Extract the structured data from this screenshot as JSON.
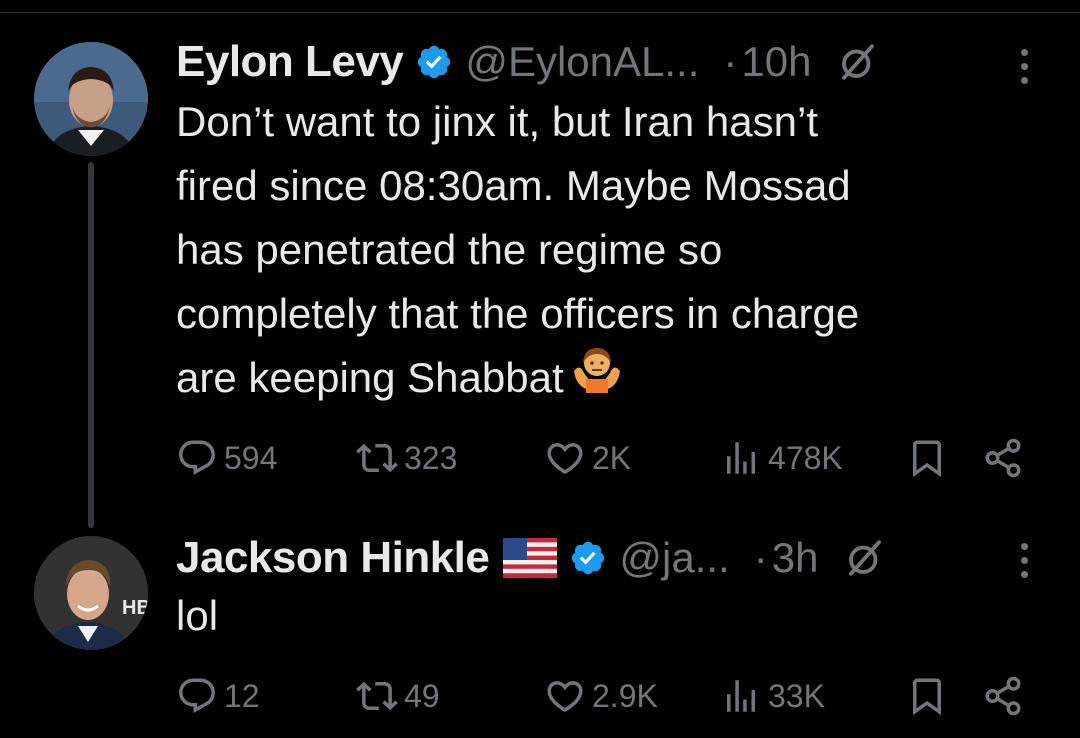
{
  "colors": {
    "background": "#000000",
    "text_primary": "#e7e9ea",
    "text_secondary": "#71767b",
    "verified": "#1d9bf0",
    "thread_line": "#333639"
  },
  "tweets": [
    {
      "author": {
        "name": "Eylon Levy",
        "handle": "@EylonAL...",
        "verified": true
      },
      "separator": "·",
      "time": "10h",
      "text_lines": [
        "Don’t want to jinx it, but Iran hasn’t",
        "fired since 08:30am. Maybe Mossad",
        "has penetrated the regime so",
        "completely that the officers in charge",
        "are keeping Shabbat"
      ],
      "trailing_emoji": "person-shrugging-emoji",
      "stats": {
        "replies": "594",
        "reposts": "323",
        "likes": "2K",
        "views": "478K"
      }
    },
    {
      "author": {
        "name": "Jackson Hinkle",
        "name_emoji": "us-flag-emoji",
        "handle": "@ja...",
        "verified": true
      },
      "separator": "·",
      "time": "3h",
      "text_lines": [
        "lol"
      ],
      "stats": {
        "replies": "12",
        "reposts": "49",
        "likes": "2.9K",
        "views": "33K"
      }
    }
  ],
  "icons": {
    "reply": "reply-bubble-icon",
    "repost": "repost-icon",
    "like": "heart-icon",
    "views": "views-bar-chart-icon",
    "bookmark": "bookmark-icon",
    "share": "share-icon",
    "grok": "grok-icon",
    "more": "more-options-icon"
  }
}
